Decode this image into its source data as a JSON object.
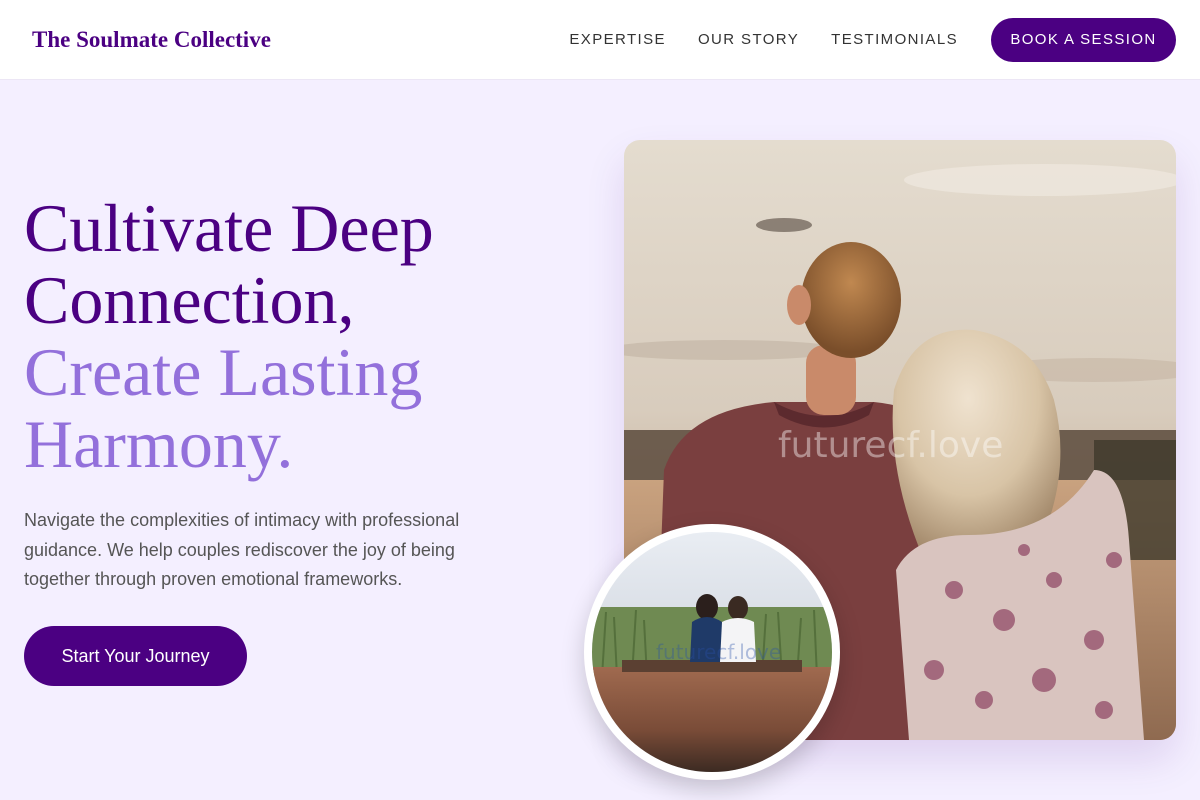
{
  "brand": {
    "name": "The Soulmate Collective"
  },
  "nav": {
    "links": [
      {
        "label": "EXPERTISE"
      },
      {
        "label": "OUR STORY"
      },
      {
        "label": "TESTIMONIALS"
      }
    ],
    "cta_label": "BOOK A SESSION"
  },
  "hero": {
    "title_line1": "Cultivate Deep",
    "title_line2": "Connection,",
    "title_line3": "Create Lasting",
    "title_line4": "Harmony.",
    "subtitle": "Navigate the complexities of intimacy with professional guidance. We help couples rediscover the joy of being together through proven emotional frameworks.",
    "cta_label": "Start Your Journey"
  },
  "images": {
    "main_watermark": "futurecf.love",
    "inset_watermark": "futurecf.love"
  },
  "colors": {
    "brand_purple": "#4b0082",
    "accent_lavender": "#9370db",
    "page_background": "#f4efff"
  }
}
